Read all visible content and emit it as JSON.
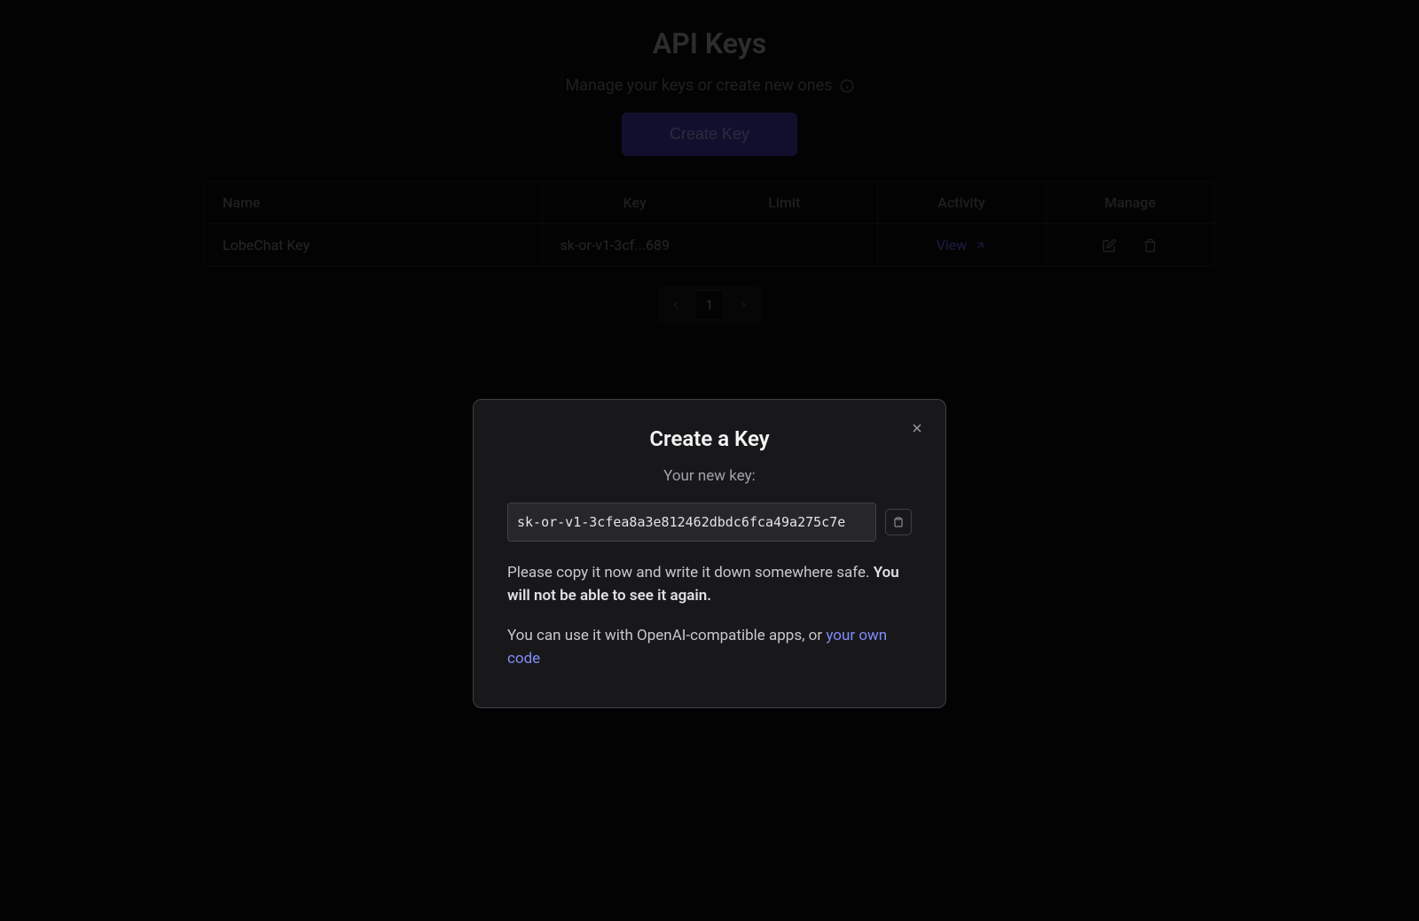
{
  "header": {
    "title": "API Keys",
    "subtitle": "Manage your keys or create new ones"
  },
  "actions": {
    "create_label": "Create Key"
  },
  "table": {
    "headers": {
      "name": "Name",
      "key": "Key",
      "limit": "Limit",
      "activity": "Activity",
      "manage": "Manage"
    },
    "rows": [
      {
        "name": "LobeChat Key",
        "key": "sk-or-v1-3cf...689",
        "limit": "",
        "view_label": "View"
      }
    ]
  },
  "pagination": {
    "current": "1"
  },
  "modal": {
    "title": "Create a Key",
    "subtitle": "Your new key:",
    "key_value": "sk-or-v1-3cfea8a3e812462dbdc6fca49a275c7e",
    "warning_prefix": "Please copy it now and write it down somewhere safe. ",
    "warning_bold": "You will not be able to see it again.",
    "usage_prefix": "You can use it with OpenAI-compatible apps, or ",
    "usage_link": "your own code"
  }
}
